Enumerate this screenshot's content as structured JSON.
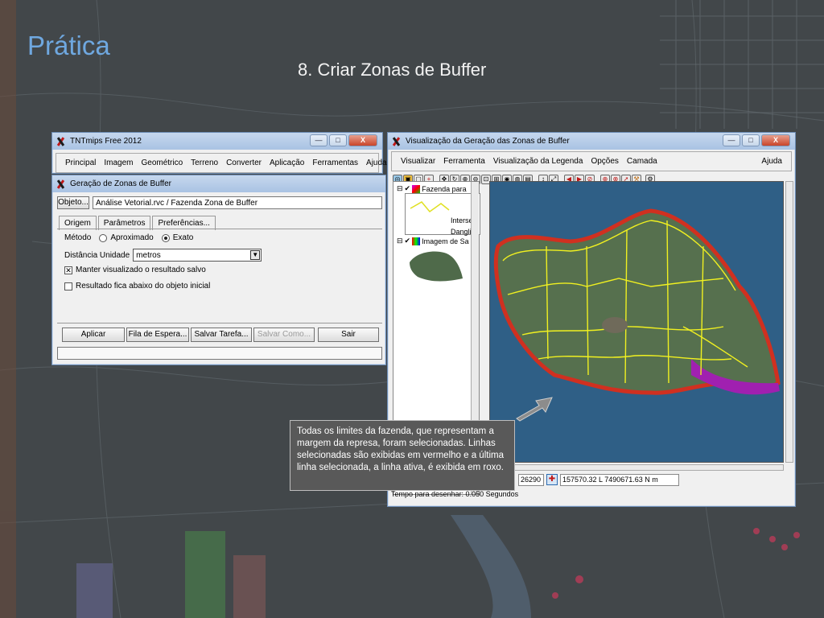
{
  "slide": {
    "title": "Prática",
    "subtitle": "8. Criar Zonas de Buffer"
  },
  "main_window": {
    "title": "TNTmips Free 2012",
    "menu": [
      "Principal",
      "Imagem",
      "Geométrico",
      "Terreno",
      "Converter",
      "Aplicação",
      "Ferramentas",
      "Ajuda"
    ],
    "buttons": {
      "minimize": "—",
      "maximize": "□",
      "close": "X"
    }
  },
  "buffer_dialog": {
    "title": "Geração de Zonas de Buffer",
    "object_button": "Objeto...",
    "object_value": "Análise Vetorial.rvc / Fazenda Zona de Buffer",
    "tabs": [
      "Origem",
      "Parâmetros",
      "Preferências..."
    ],
    "method_label": "Método",
    "method_options": [
      "Aproximado",
      "Exato"
    ],
    "method_selected": "Exato",
    "distance_unit_label": "Distância Unidade",
    "distance_unit_value": "metros",
    "keep_view_label": "Manter visualizado o resultado salvo",
    "keep_view_checked": true,
    "result_below_label": "Resultado fica abaixo do objeto inicial",
    "result_below_checked": false,
    "actions": {
      "apply": "Aplicar",
      "queue": "Fila de Espera...",
      "save_task": "Salvar Tarefa...",
      "save_as": "Salvar Como...",
      "exit": "Sair"
    }
  },
  "view_window": {
    "title": "Visualização da Geração das Zonas de Buffer",
    "menu": [
      "Visualizar",
      "Ferramenta",
      "Visualização da Legenda",
      "Opções",
      "Camada"
    ],
    "help": "Ajuda",
    "legend": {
      "layer1": "Fazenda para",
      "layer1_sub1": "Intersec",
      "layer1_sub2": "Dangling",
      "layer2": "Imagem de Sa"
    },
    "status": {
      "scale": "26290",
      "coords": "157570.32 L  7490671.63 N m",
      "draw_time": "Tempo para desenhar: 0.050 Segundos"
    }
  },
  "callout": {
    "text": "Todas os limites da fazenda, que representam a margem da represa, foram selecionadas. Linhas selecionadas são exibidas em vermelho e a última linha selecionada, a linha ativa, é exibida em roxo."
  },
  "colors": {
    "title_accent": "#6fa8e0",
    "selected_line": "#e02020",
    "active_line": "#b020c0",
    "field_lines": "#f0f020",
    "water": "#2f5f86"
  }
}
